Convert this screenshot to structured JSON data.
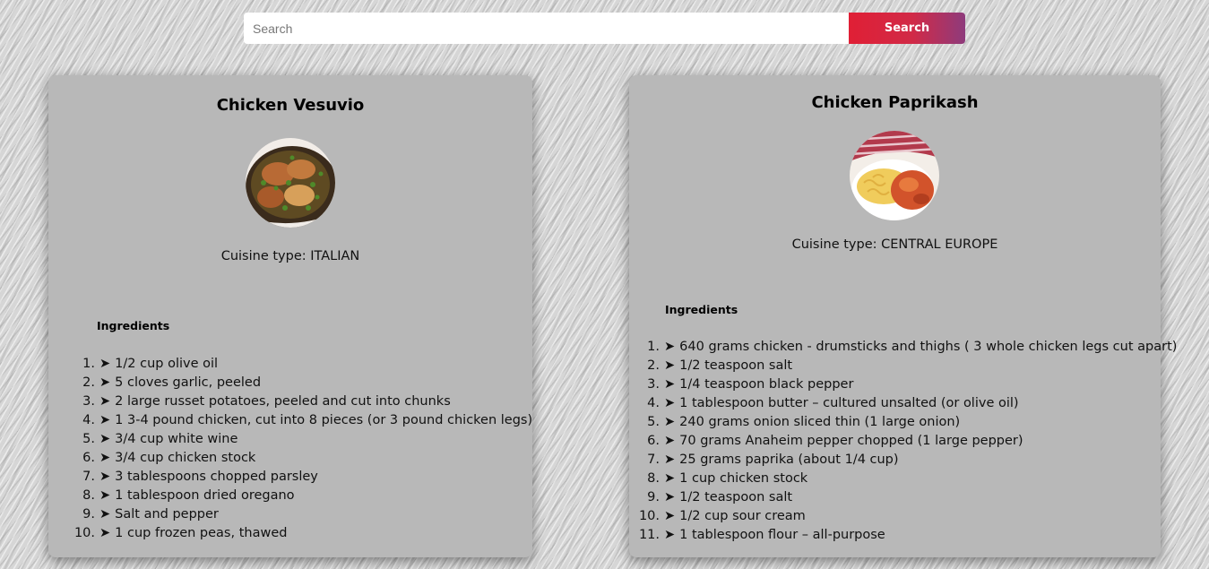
{
  "search": {
    "placeholder": "Search",
    "button_label": "Search"
  },
  "recipes": [
    {
      "title": "Chicken Vesuvio",
      "image_icon": "chicken-vesuvio-photo",
      "cuisine_label": "Cuisine type: ITALIAN",
      "ingredients_heading": "Ingredients",
      "bullet": "➤",
      "ingredients": [
        "1/2 cup olive oil",
        "5 cloves garlic, peeled",
        "2 large russet potatoes, peeled and cut into chunks",
        "1 3-4 pound chicken, cut into 8 pieces (or 3 pound chicken legs)",
        "3/4 cup white wine",
        "3/4 cup chicken stock",
        "3 tablespoons chopped parsley",
        "1 tablespoon dried oregano",
        "Salt and pepper",
        "1 cup frozen peas, thawed"
      ]
    },
    {
      "title": "Chicken Paprikash",
      "image_icon": "chicken-paprikash-photo",
      "cuisine_label": "Cuisine type: CENTRAL EUROPE",
      "ingredients_heading": "Ingredients",
      "bullet": "➤",
      "ingredients": [
        "640 grams chicken - drumsticks and thighs ( 3 whole chicken legs cut apart)",
        "1/2 teaspoon salt",
        "1/4 teaspoon black pepper",
        "1 tablespoon butter – cultured unsalted (or olive oil)",
        "240 grams onion sliced thin (1 large onion)",
        "70 grams Anaheim pepper chopped (1 large pepper)",
        "25 grams paprika (about 1/4 cup)",
        "1 cup chicken stock",
        "1/2 teaspoon salt",
        "1/2 cup sour cream",
        "1 tablespoon flour – all-purpose"
      ]
    }
  ],
  "colors": {
    "card_bg": "#b8b8b8",
    "button_start": "#e01f35",
    "button_end": "#8e3b7c"
  }
}
